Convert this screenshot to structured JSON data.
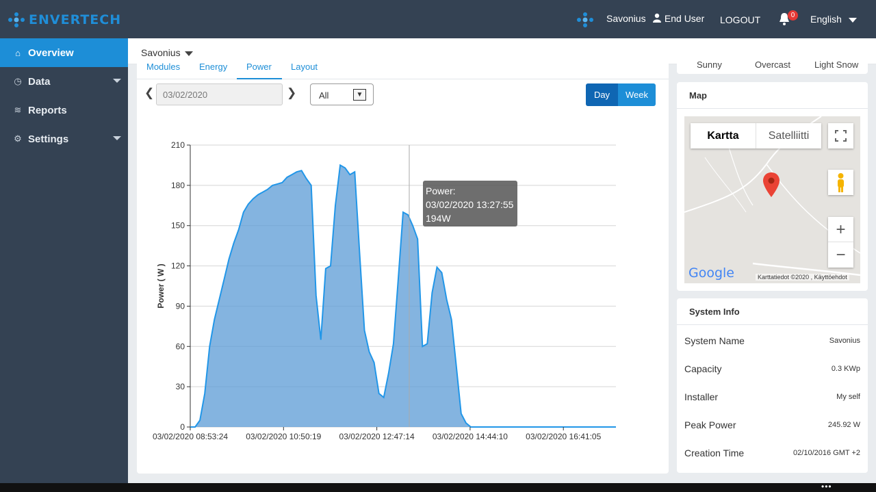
{
  "header": {
    "logo_text": "ENVERTECH",
    "system_name": "Savonius",
    "user_label": "End User",
    "logout_label": "LOGOUT",
    "notification_count": "0",
    "language": "English"
  },
  "sidebar": {
    "items": [
      {
        "label": "Overview",
        "icon": "home-icon",
        "active": true
      },
      {
        "label": "Data",
        "icon": "clock-icon",
        "has_submenu": true
      },
      {
        "label": "Reports",
        "icon": "stack-icon"
      },
      {
        "label": "Settings",
        "icon": "gear-icon",
        "has_submenu": true
      }
    ]
  },
  "breadcrumb": {
    "system": "Savonius"
  },
  "main": {
    "tabs": [
      {
        "label": "Modules"
      },
      {
        "label": "Energy"
      },
      {
        "label": "Power",
        "active": true
      },
      {
        "label": "Layout"
      }
    ],
    "date_value": "03/02/2020",
    "select_value": "All",
    "day_label": "Day",
    "week_label": "Week"
  },
  "tooltip": {
    "line1": "Power:",
    "line2": "03/02/2020 13:27:55",
    "line3": "194W"
  },
  "chart_data": {
    "type": "area",
    "title": "",
    "xlabel": "",
    "ylabel": "Power ( W )",
    "ylim": [
      0,
      210
    ],
    "yticks": [
      0,
      30,
      60,
      90,
      120,
      150,
      180,
      210
    ],
    "xtick_labels": [
      "03/02/2020 08:53:24",
      "03/02/2020 10:50:19",
      "03/02/2020 12:47:14",
      "03/02/2020 14:44:10",
      "03/02/2020 16:41:05"
    ],
    "grid": true,
    "color": "#2196e8",
    "x": [
      "08:53",
      "09:05",
      "09:10",
      "09:15",
      "09:20",
      "09:25",
      "09:30",
      "09:35",
      "09:40",
      "09:45",
      "09:50",
      "10:00",
      "10:05",
      "10:10",
      "10:15",
      "10:20",
      "10:25",
      "10:30",
      "10:35",
      "10:40",
      "10:45",
      "10:50",
      "11:00",
      "11:10",
      "11:20",
      "11:30",
      "11:40",
      "11:50",
      "12:00",
      "12:10",
      "12:20",
      "12:25",
      "12:30",
      "12:35",
      "12:40",
      "12:45",
      "12:50",
      "12:55",
      "13:00",
      "13:05",
      "13:10",
      "13:15",
      "13:20",
      "13:25",
      "13:30",
      "13:35",
      "13:40",
      "13:45",
      "13:50",
      "13:55",
      "14:00",
      "14:05",
      "14:10",
      "14:15",
      "14:20",
      "14:25",
      "14:30",
      "14:35",
      "14:40",
      "14:45",
      "14:50",
      "14:55",
      "15:00",
      "15:05",
      "15:10",
      "15:15",
      "15:20",
      "15:25",
      "15:30",
      "15:35",
      "15:40",
      "15:45",
      "15:50",
      "15:55",
      "16:00",
      "16:05",
      "16:10",
      "16:15",
      "16:20",
      "16:25",
      "16:30",
      "16:35",
      "16:40",
      "16:45",
      "16:50",
      "16:55",
      "17:00",
      "17:05",
      "17:10"
    ],
    "values": [
      0,
      0,
      5,
      25,
      60,
      80,
      95,
      110,
      125,
      137,
      147,
      160,
      166,
      170,
      173,
      175,
      177,
      180,
      181,
      182,
      186,
      188,
      190,
      191,
      185,
      180,
      98,
      65,
      118,
      120,
      165,
      195,
      193,
      188,
      190,
      130,
      72,
      56,
      48,
      25,
      22,
      40,
      62,
      110,
      160,
      158,
      150,
      140,
      60,
      62,
      100,
      119,
      115,
      95,
      80,
      45,
      10,
      3,
      0,
      0,
      0,
      0,
      0,
      0,
      0,
      0,
      0,
      0,
      0,
      0,
      0,
      0,
      0,
      0,
      0,
      0,
      0,
      0,
      0,
      0,
      0,
      0,
      0,
      0,
      0,
      0,
      0,
      0,
      0
    ]
  },
  "right_top": {
    "labels": [
      "Sunny",
      "Overcast",
      "Light Snow"
    ]
  },
  "map": {
    "title": "Map",
    "map_label": "Kartta",
    "satellite_label": "Satelliitti",
    "logo": "Google",
    "attribution": "Karttatiedot ©2020 , Käyttöehdot"
  },
  "system_info": {
    "title": "System Info",
    "rows": [
      {
        "label": "System Name",
        "value": "Savonius"
      },
      {
        "label": "Capacity",
        "value": "0.3 KWp"
      },
      {
        "label": "Installer",
        "value": "My self"
      },
      {
        "label": "Peak Power",
        "value": "245.92 W"
      },
      {
        "label": "Creation Time",
        "value": "02/10/2016 GMT +2"
      }
    ]
  }
}
